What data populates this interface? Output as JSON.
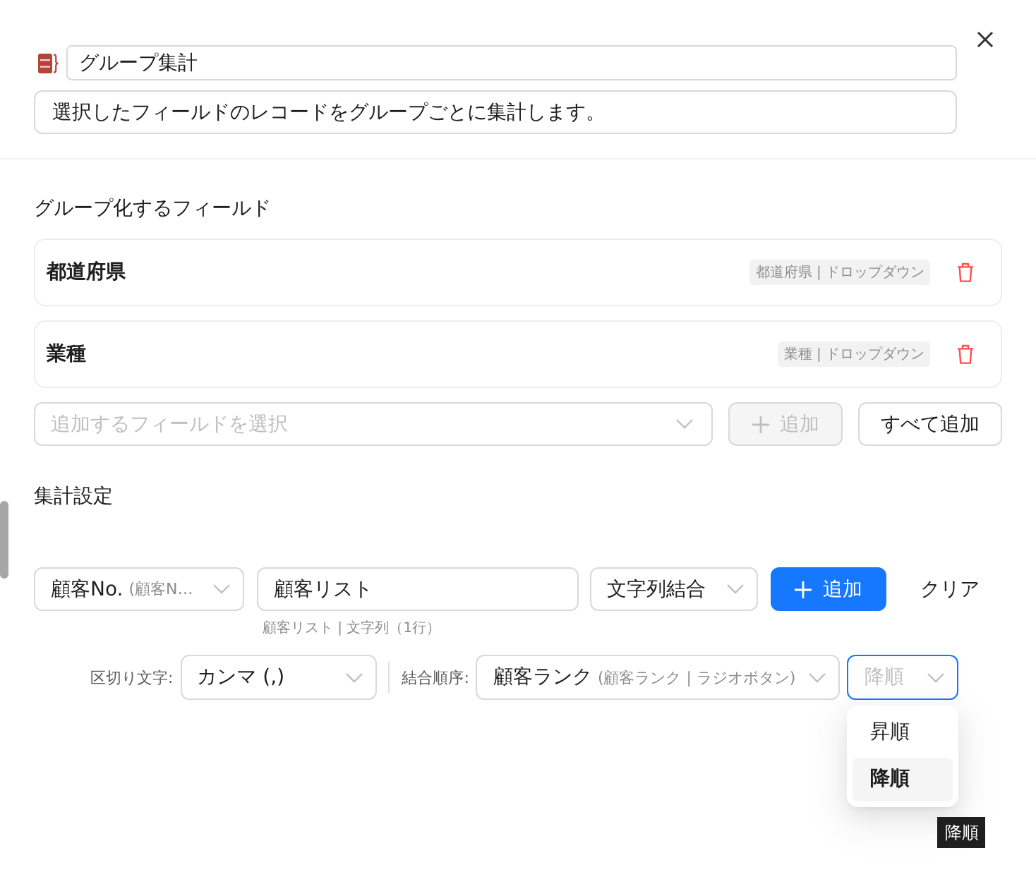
{
  "header": {
    "title": "グループ集計",
    "description": "選択したフィールドのレコードをグループごとに集計します。"
  },
  "group_section": {
    "heading": "グループ化するフィールド",
    "fields": [
      {
        "name": "都道府県",
        "tag": "都道府県 | ドロップダウン"
      },
      {
        "name": "業種",
        "tag": "業種 | ドロップダウン"
      }
    ],
    "field_picker": {
      "placeholder": "追加するフィールドを選択"
    },
    "add_button": {
      "label": "追加",
      "disabled": true
    },
    "add_all_button": {
      "label": "すべて追加"
    }
  },
  "aggregate_section": {
    "heading": "集計設定",
    "source_field": {
      "value": "顧客No.",
      "detail": "(顧客N…"
    },
    "output_name": {
      "value": "顧客リスト",
      "hint": "顧客リスト | 文字列（1行）"
    },
    "function": {
      "value": "文字列結合"
    },
    "add_button": {
      "label": "追加",
      "disabled": false
    },
    "clear_button": {
      "label": "クリア"
    },
    "separator": {
      "label": "区切り文字:",
      "value": "カンマ (,)"
    },
    "order_field": {
      "label": "結合順序:",
      "value": "顧客ランク",
      "detail": "(顧客ランク | ラジオボタン)"
    },
    "order_direction": {
      "value": "降順",
      "open": true,
      "options": [
        {
          "label": "昇順",
          "selected": false
        },
        {
          "label": "降順",
          "selected": true
        }
      ],
      "tooltip": "降順"
    }
  }
}
